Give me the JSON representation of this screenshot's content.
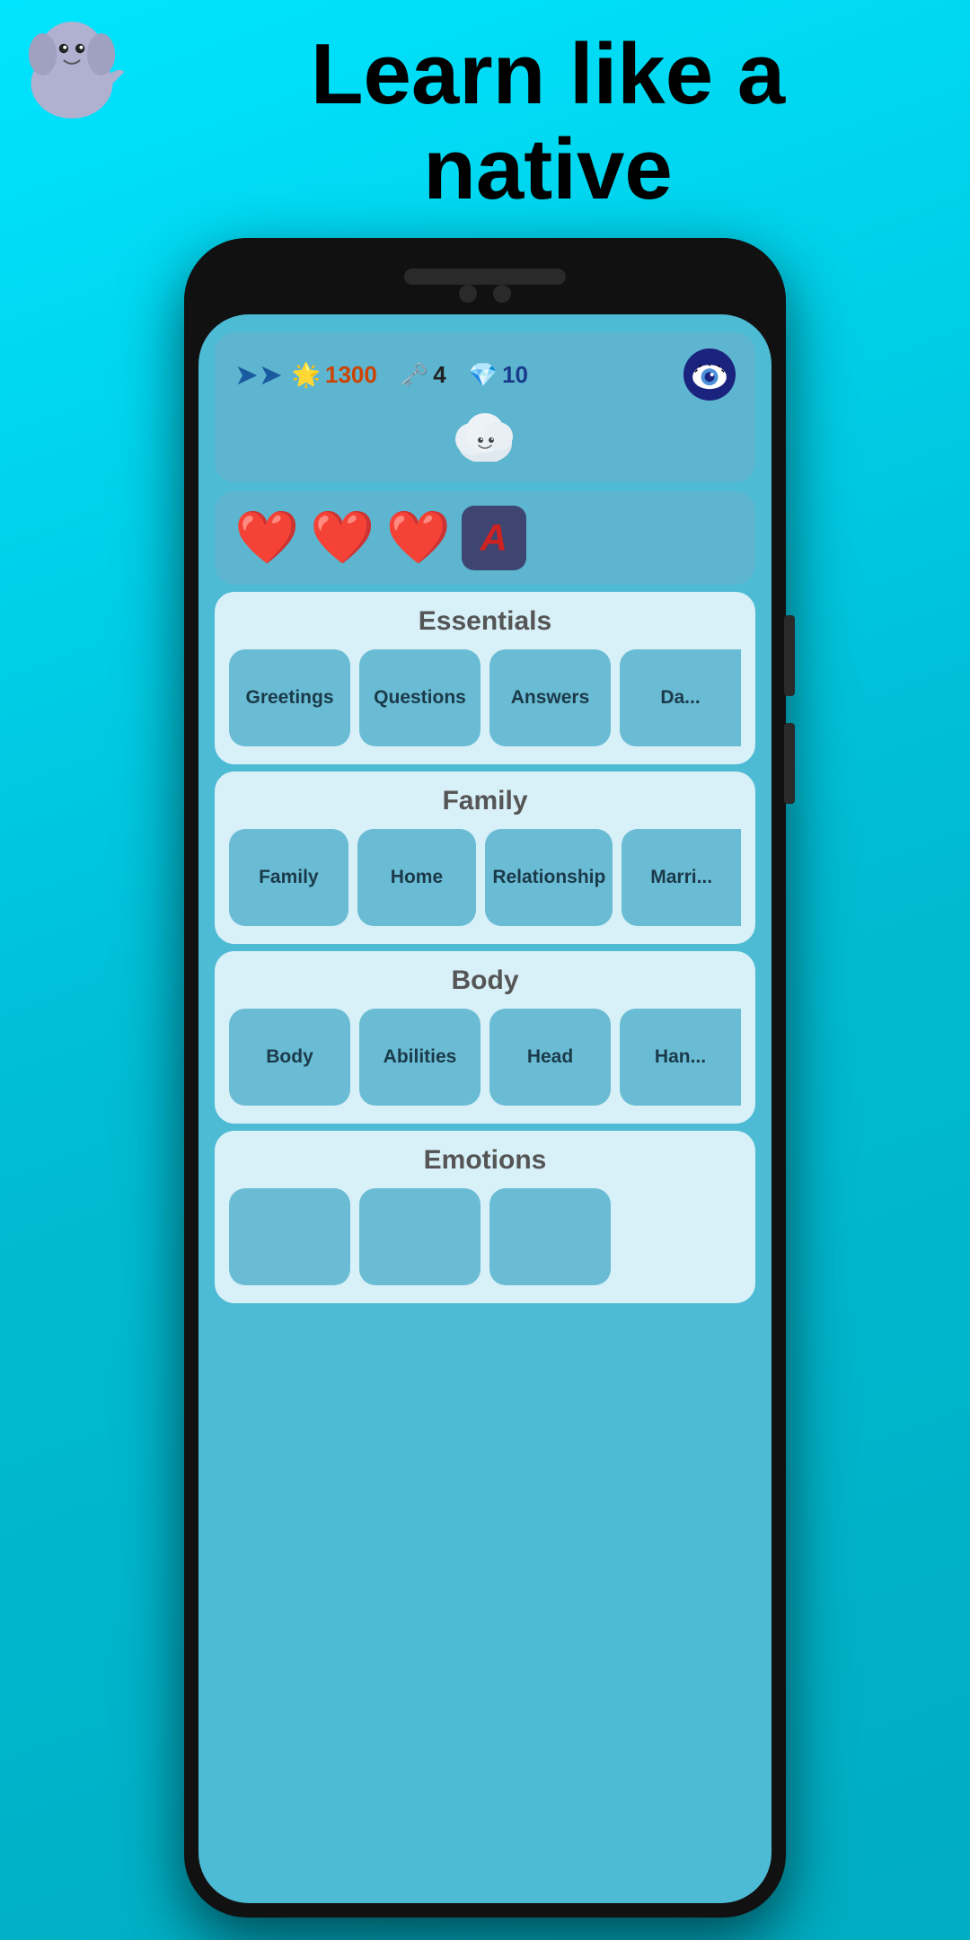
{
  "header": {
    "title_line1": "Learn like a",
    "title_line2": "native"
  },
  "stats": {
    "sun_count": "1300",
    "key_count": "4",
    "gem_count": "10"
  },
  "sections": [
    {
      "id": "essentials",
      "title": "Essentials",
      "categories": [
        "Greetings",
        "Questions",
        "Answers",
        "Da..."
      ]
    },
    {
      "id": "family",
      "title": "Family",
      "categories": [
        "Family",
        "Home",
        "Relationship",
        "Marri..."
      ]
    },
    {
      "id": "body",
      "title": "Body",
      "categories": [
        "Body",
        "Abilities",
        "Head",
        "Han..."
      ]
    },
    {
      "id": "emotions",
      "title": "Emotions",
      "categories": [
        "",
        "",
        ""
      ]
    }
  ]
}
